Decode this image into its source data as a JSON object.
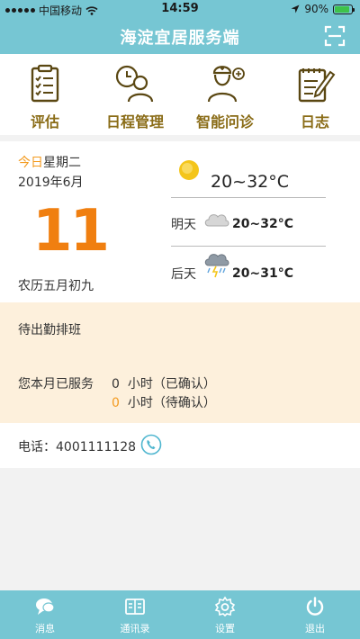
{
  "status_bar": {
    "carrier": "中国移动",
    "time": "14:59",
    "battery": "90%",
    "battery_level": 0.9,
    "accent_color": "#76c6d3"
  },
  "header": {
    "title": "海淀宜居服务端",
    "scan_icon": "scan-icon"
  },
  "functions": [
    {
      "label": "评估",
      "icon": "clipboard-icon"
    },
    {
      "label": "日程管理",
      "icon": "schedule-person-icon"
    },
    {
      "label": "智能问诊",
      "icon": "doctor-icon"
    },
    {
      "label": "日志",
      "icon": "notepad-pen-icon"
    }
  ],
  "date": {
    "today_word": "今日",
    "weekday": "星期二",
    "year_month": "2019年6月",
    "day": "11",
    "lunar": "农历五月初九"
  },
  "weather": {
    "today": {
      "temp": "20~32°C",
      "icon": "sun-icon"
    },
    "tomorrow": {
      "label": "明天",
      "temp": "20~32°C",
      "icon": "cloud-icon"
    },
    "day_after": {
      "label": "后天",
      "temp": "20~31°C",
      "icon": "thunderstorm-icon"
    }
  },
  "service": {
    "schedule_status": "待出勤排班",
    "served_label": "您本月已服务",
    "confirmed_value": "0",
    "confirmed_unit": "小时（已确认）",
    "pending_value": "0",
    "pending_unit": "小时（待确认）"
  },
  "contact": {
    "phone_label": "电话：",
    "phone_number": "4001111128",
    "icon": "phone-icon"
  },
  "tabs": [
    {
      "label": "消息",
      "icon": "chat-bubble-icon"
    },
    {
      "label": "通讯录",
      "icon": "contacts-icon"
    },
    {
      "label": "设置",
      "icon": "gear-icon"
    },
    {
      "label": "退出",
      "icon": "power-icon"
    }
  ]
}
